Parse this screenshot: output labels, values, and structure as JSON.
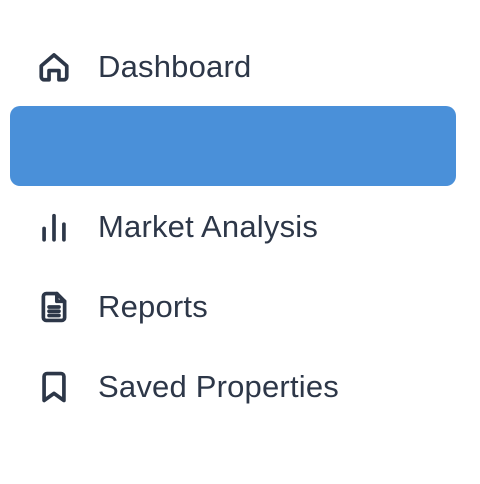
{
  "colors": {
    "text": "#2d3748",
    "active_background": "#4a90d9",
    "background": "#ffffff"
  },
  "sidebar": {
    "items": [
      {
        "label": "Dashboard",
        "icon": "home-icon",
        "active": false
      },
      {
        "label": "",
        "icon": "",
        "active": true
      },
      {
        "label": "Market Analysis",
        "icon": "bar-chart-icon",
        "active": false
      },
      {
        "label": "Reports",
        "icon": "document-icon",
        "active": false
      },
      {
        "label": "Saved Properties",
        "icon": "bookmark-icon",
        "active": false
      }
    ]
  }
}
